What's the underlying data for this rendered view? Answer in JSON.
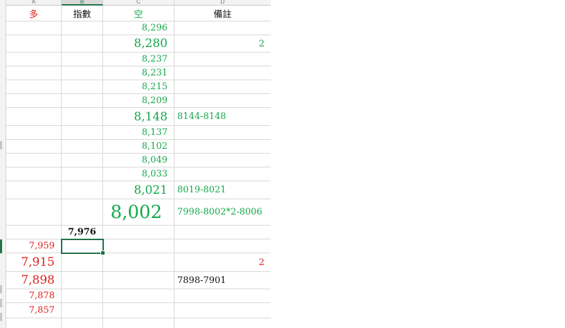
{
  "columns": {
    "a": "A",
    "b": "B",
    "c": "C",
    "d": "D"
  },
  "headers": {
    "a": "多",
    "b": "指數",
    "c": "空",
    "d": "備註"
  },
  "rows": [
    {
      "c": "8,296",
      "d": ""
    },
    {
      "c": "8,280",
      "d": "2"
    },
    {
      "c": "8,237",
      "d": ""
    },
    {
      "c": "8,231",
      "d": ""
    },
    {
      "c": "8,215",
      "d": ""
    },
    {
      "c": "8,209",
      "d": ""
    },
    {
      "c": "8,148",
      "d": "8144-8148"
    },
    {
      "c": "8,137",
      "d": ""
    },
    {
      "c": "8,102",
      "d": ""
    },
    {
      "c": "8,049",
      "d": ""
    },
    {
      "c": "8,033",
      "d": ""
    },
    {
      "c": "8,021",
      "d": "8019-8021"
    },
    {
      "c": "8,002",
      "d": "7998-8002*2-8006"
    },
    {
      "b": "7,976"
    },
    {
      "a": "7,959"
    },
    {
      "a": "7,915",
      "d": "2"
    },
    {
      "a": "7,898",
      "d": "7898-7901"
    },
    {
      "a": "7,878"
    },
    {
      "a": "7,857"
    }
  ],
  "colors": {
    "green": "#14a84b",
    "red": "#e0211b",
    "selection": "#1e7145"
  }
}
